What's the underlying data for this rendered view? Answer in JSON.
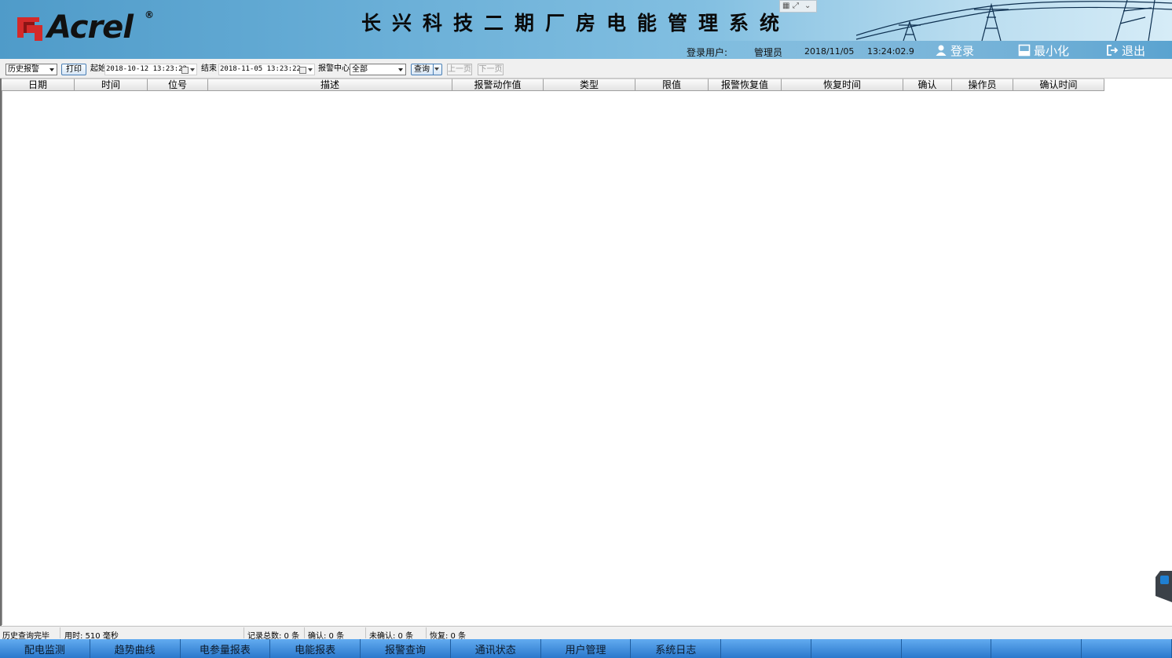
{
  "header": {
    "brand": "Acrel",
    "brand_reg": "®",
    "title": "长兴科技二期厂房电能管理系统",
    "user_label": "登录用户:",
    "user_name": "管理员",
    "date": "2018/11/05",
    "time": "13:24:02.9",
    "login_label": "登录",
    "minimize_label": "最小化",
    "exit_label": "退出",
    "accent_color": "#5aa3d0"
  },
  "toolbar": {
    "mode_select": "历史报警",
    "print_label": "打印",
    "start_label": "起始",
    "start_value": "2018-10-12 13:23:22",
    "end_label": "结束",
    "end_value": "2018-11-05 13:23:22",
    "center_label": "报警中心",
    "center_select": "全部",
    "query_label": "查询",
    "prev_label": "上一页",
    "next_label": "下一页"
  },
  "table": {
    "columns": [
      {
        "label": "日期"
      },
      {
        "label": "时间"
      },
      {
        "label": "位号"
      },
      {
        "label": "描述"
      },
      {
        "label": "报警动作值"
      },
      {
        "label": "类型"
      },
      {
        "label": "限值"
      },
      {
        "label": "报警恢复值"
      },
      {
        "label": "恢复时间"
      },
      {
        "label": "确认"
      },
      {
        "label": "操作员"
      },
      {
        "label": "确认时间"
      }
    ],
    "rows": []
  },
  "status": {
    "message": "历史查询完毕",
    "elapsed": "用时: 510 毫秒",
    "total": "记录总数: 0 条",
    "confirmed": "确认: 0 条",
    "unconfirmed": "未确认: 0 条",
    "recovered": "恢复: 0 条"
  },
  "nav": {
    "items": [
      "配电监测",
      "趋势曲线",
      "电参量报表",
      "电能报表",
      "报警查询",
      "通讯状态",
      "用户管理",
      "系统日志",
      "",
      "",
      "",
      "",
      ""
    ]
  },
  "icons": {
    "logo": "acrel-logo-icon",
    "user": "user-icon",
    "minimize": "minimize-icon",
    "exit": "exit-icon",
    "calendar": "calendar-icon"
  }
}
